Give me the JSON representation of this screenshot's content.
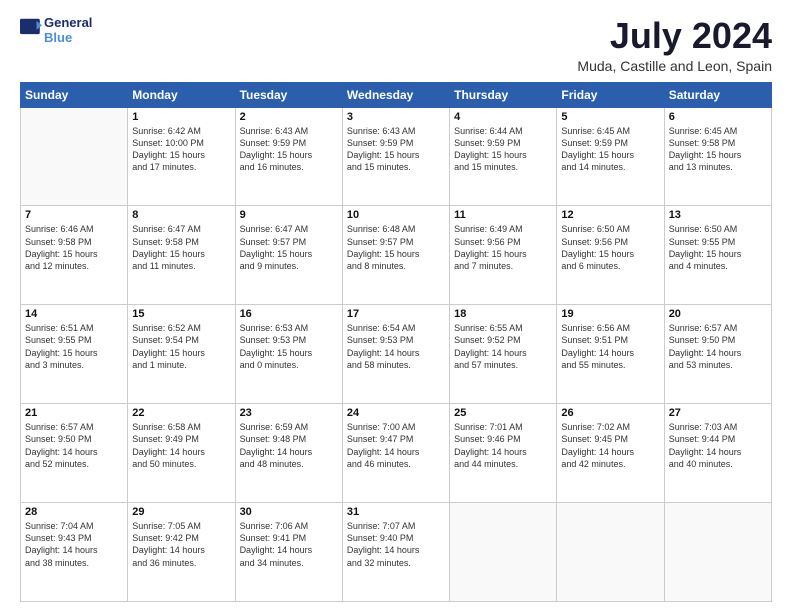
{
  "logo": {
    "line1": "General",
    "line2": "Blue"
  },
  "title": "July 2024",
  "location": "Muda, Castille and Leon, Spain",
  "days_header": [
    "Sunday",
    "Monday",
    "Tuesday",
    "Wednesday",
    "Thursday",
    "Friday",
    "Saturday"
  ],
  "weeks": [
    [
      {
        "day": "",
        "info": ""
      },
      {
        "day": "1",
        "info": "Sunrise: 6:42 AM\nSunset: 10:00 PM\nDaylight: 15 hours\nand 17 minutes."
      },
      {
        "day": "2",
        "info": "Sunrise: 6:43 AM\nSunset: 9:59 PM\nDaylight: 15 hours\nand 16 minutes."
      },
      {
        "day": "3",
        "info": "Sunrise: 6:43 AM\nSunset: 9:59 PM\nDaylight: 15 hours\nand 15 minutes."
      },
      {
        "day": "4",
        "info": "Sunrise: 6:44 AM\nSunset: 9:59 PM\nDaylight: 15 hours\nand 15 minutes."
      },
      {
        "day": "5",
        "info": "Sunrise: 6:45 AM\nSunset: 9:59 PM\nDaylight: 15 hours\nand 14 minutes."
      },
      {
        "day": "6",
        "info": "Sunrise: 6:45 AM\nSunset: 9:58 PM\nDaylight: 15 hours\nand 13 minutes."
      }
    ],
    [
      {
        "day": "7",
        "info": "Sunrise: 6:46 AM\nSunset: 9:58 PM\nDaylight: 15 hours\nand 12 minutes."
      },
      {
        "day": "8",
        "info": "Sunrise: 6:47 AM\nSunset: 9:58 PM\nDaylight: 15 hours\nand 11 minutes."
      },
      {
        "day": "9",
        "info": "Sunrise: 6:47 AM\nSunset: 9:57 PM\nDaylight: 15 hours\nand 9 minutes."
      },
      {
        "day": "10",
        "info": "Sunrise: 6:48 AM\nSunset: 9:57 PM\nDaylight: 15 hours\nand 8 minutes."
      },
      {
        "day": "11",
        "info": "Sunrise: 6:49 AM\nSunset: 9:56 PM\nDaylight: 15 hours\nand 7 minutes."
      },
      {
        "day": "12",
        "info": "Sunrise: 6:50 AM\nSunset: 9:56 PM\nDaylight: 15 hours\nand 6 minutes."
      },
      {
        "day": "13",
        "info": "Sunrise: 6:50 AM\nSunset: 9:55 PM\nDaylight: 15 hours\nand 4 minutes."
      }
    ],
    [
      {
        "day": "14",
        "info": "Sunrise: 6:51 AM\nSunset: 9:55 PM\nDaylight: 15 hours\nand 3 minutes."
      },
      {
        "day": "15",
        "info": "Sunrise: 6:52 AM\nSunset: 9:54 PM\nDaylight: 15 hours\nand 1 minute."
      },
      {
        "day": "16",
        "info": "Sunrise: 6:53 AM\nSunset: 9:53 PM\nDaylight: 15 hours\nand 0 minutes."
      },
      {
        "day": "17",
        "info": "Sunrise: 6:54 AM\nSunset: 9:53 PM\nDaylight: 14 hours\nand 58 minutes."
      },
      {
        "day": "18",
        "info": "Sunrise: 6:55 AM\nSunset: 9:52 PM\nDaylight: 14 hours\nand 57 minutes."
      },
      {
        "day": "19",
        "info": "Sunrise: 6:56 AM\nSunset: 9:51 PM\nDaylight: 14 hours\nand 55 minutes."
      },
      {
        "day": "20",
        "info": "Sunrise: 6:57 AM\nSunset: 9:50 PM\nDaylight: 14 hours\nand 53 minutes."
      }
    ],
    [
      {
        "day": "21",
        "info": "Sunrise: 6:57 AM\nSunset: 9:50 PM\nDaylight: 14 hours\nand 52 minutes."
      },
      {
        "day": "22",
        "info": "Sunrise: 6:58 AM\nSunset: 9:49 PM\nDaylight: 14 hours\nand 50 minutes."
      },
      {
        "day": "23",
        "info": "Sunrise: 6:59 AM\nSunset: 9:48 PM\nDaylight: 14 hours\nand 48 minutes."
      },
      {
        "day": "24",
        "info": "Sunrise: 7:00 AM\nSunset: 9:47 PM\nDaylight: 14 hours\nand 46 minutes."
      },
      {
        "day": "25",
        "info": "Sunrise: 7:01 AM\nSunset: 9:46 PM\nDaylight: 14 hours\nand 44 minutes."
      },
      {
        "day": "26",
        "info": "Sunrise: 7:02 AM\nSunset: 9:45 PM\nDaylight: 14 hours\nand 42 minutes."
      },
      {
        "day": "27",
        "info": "Sunrise: 7:03 AM\nSunset: 9:44 PM\nDaylight: 14 hours\nand 40 minutes."
      }
    ],
    [
      {
        "day": "28",
        "info": "Sunrise: 7:04 AM\nSunset: 9:43 PM\nDaylight: 14 hours\nand 38 minutes."
      },
      {
        "day": "29",
        "info": "Sunrise: 7:05 AM\nSunset: 9:42 PM\nDaylight: 14 hours\nand 36 minutes."
      },
      {
        "day": "30",
        "info": "Sunrise: 7:06 AM\nSunset: 9:41 PM\nDaylight: 14 hours\nand 34 minutes."
      },
      {
        "day": "31",
        "info": "Sunrise: 7:07 AM\nSunset: 9:40 PM\nDaylight: 14 hours\nand 32 minutes."
      },
      {
        "day": "",
        "info": ""
      },
      {
        "day": "",
        "info": ""
      },
      {
        "day": "",
        "info": ""
      }
    ]
  ]
}
